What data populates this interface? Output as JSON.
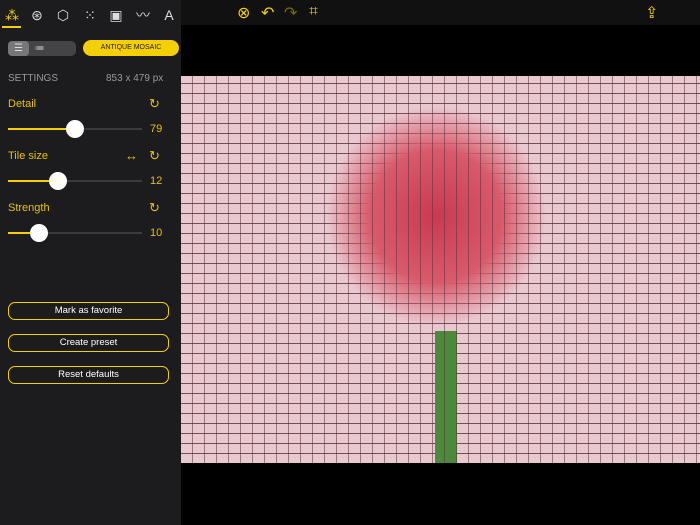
{
  "toolbar": {
    "icons": [
      "close-circle-icon",
      "undo-icon",
      "redo-icon",
      "crop-icon",
      "share-icon"
    ],
    "accent": "#f5d000"
  },
  "tabs": [
    {
      "icon": "magic-wand-icon",
      "glyph": "⁂"
    },
    {
      "icon": "color-circles-icon",
      "glyph": "⊛"
    },
    {
      "icon": "cubes-icon",
      "glyph": "⬡"
    },
    {
      "icon": "dots-grid-icon",
      "glyph": "⁙"
    },
    {
      "icon": "image-icon",
      "glyph": "▣"
    },
    {
      "icon": "mustache-icon",
      "glyph": "〰"
    },
    {
      "icon": "text-icon",
      "glyph": "A"
    }
  ],
  "preset": "ANTIQUE MOSAIC",
  "settings": {
    "label": "SETTINGS",
    "size": "853 x 479 px"
  },
  "sliders": [
    {
      "name": "Detail",
      "value": "79",
      "fraction": 0.5
    },
    {
      "name": "Tile size",
      "value": "12",
      "fraction": 0.37
    },
    {
      "name": "Strength",
      "value": "10",
      "fraction": 0.23
    }
  ],
  "buttons": {
    "favorite": "Mark as favorite",
    "preset": "Create preset",
    "reset": "Reset defaults"
  }
}
